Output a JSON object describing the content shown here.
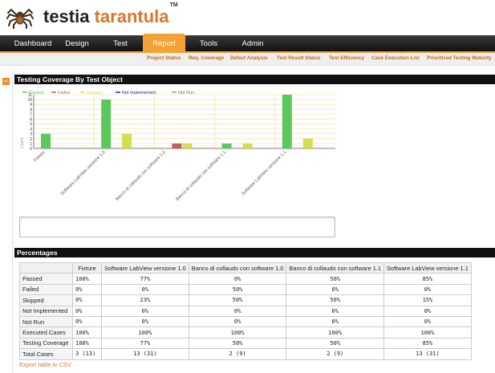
{
  "brand": {
    "name_part1": "testia",
    "name_part2": "tarantula",
    "tm": "TM"
  },
  "nav": {
    "tabs": [
      "Dashboard",
      "Design",
      "Test",
      "Report",
      "Tools",
      "Admin"
    ],
    "active": "Report"
  },
  "subnav": [
    "Project Status",
    "Req. Coverage",
    "Defect Analysis",
    "Test Result Status",
    "Test Efficiency",
    "Case Execution List",
    "Prioritized Testing Maturity"
  ],
  "section1": {
    "title": "Testing Coverage By Test Object"
  },
  "chart_data": {
    "type": "bar",
    "categories": [
      "Fixture",
      "Software LabView versione 1.0",
      "Banco di collaudo con software 1.0",
      "Banco di collaudo con software 1.1",
      "Software LabView versione 1.1"
    ],
    "series": [
      {
        "name": "Passed",
        "values": [
          3,
          10,
          0,
          1,
          11
        ]
      },
      {
        "name": "Failed",
        "values": [
          0,
          0,
          1,
          0,
          0
        ]
      },
      {
        "name": "Skipped",
        "values": [
          0,
          3,
          1,
          1,
          2
        ]
      },
      {
        "name": "Not Implemented",
        "values": [
          0,
          0,
          0,
          0,
          0
        ]
      },
      {
        "name": "Not Run",
        "values": [
          0,
          0,
          0,
          0,
          0
        ]
      }
    ],
    "colors": [
      "#5bc85b",
      "#c45c5c",
      "#d6dc50",
      "#2222aa",
      "#9a9a9a"
    ],
    "ylabel": "Count",
    "ylim": [
      0,
      11
    ],
    "yticks": [
      0,
      1,
      2,
      3,
      4,
      5,
      6,
      7,
      8,
      9,
      10,
      11
    ],
    "grid": true,
    "legend": "top-left"
  },
  "section2": {
    "title": "Percentages"
  },
  "table": {
    "headers": [
      "",
      "Fixture",
      "Software LabView versione 1.0",
      "Banco di collaudo con software 1.0",
      "Banco di collaudo con software 1.1",
      "Software LabView versione 1.1"
    ],
    "rows": [
      [
        "Passed",
        "100%",
        "77%",
        "0%",
        "50%",
        "85%"
      ],
      [
        "Failed",
        "0%",
        "0%",
        "50%",
        "0%",
        "0%"
      ],
      [
        "Skipped",
        "0%",
        "23%",
        "50%",
        "50%",
        "15%"
      ],
      [
        "Not Implemented",
        "0%",
        "0%",
        "0%",
        "0%",
        "0%"
      ],
      [
        "Not Run",
        "0%",
        "0%",
        "0%",
        "0%",
        "0%"
      ],
      [
        "Executed Cases",
        "100%",
        "100%",
        "100%",
        "100%",
        "100%"
      ],
      [
        "Testing Coverage",
        "100%",
        "77%",
        "50%",
        "50%",
        "85%"
      ],
      [
        "Total Cases",
        "3 (13)",
        "13 (31)",
        "2 (9)",
        "2 (9)",
        "13 (31)"
      ]
    ]
  },
  "export_link": "Export table to CSV"
}
